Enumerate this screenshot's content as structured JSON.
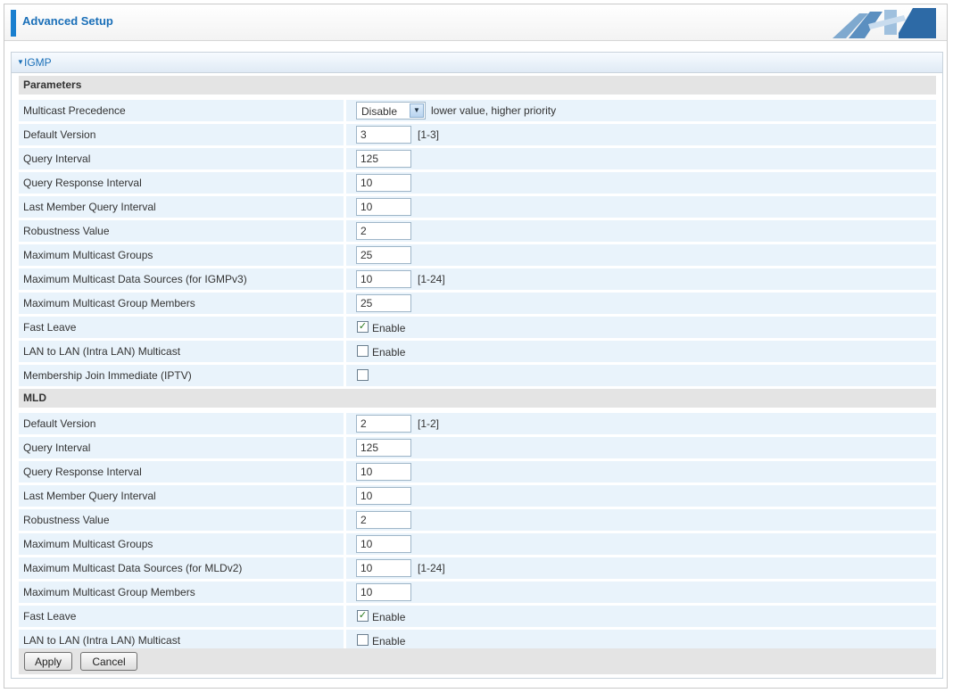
{
  "header": {
    "title": "Advanced Setup"
  },
  "panel": {
    "title": "IGMP"
  },
  "igmp": {
    "section": "Parameters",
    "precedence": {
      "label": "Multicast Precedence",
      "value": "Disable",
      "hint": "lower value, higher priority"
    },
    "default_version": {
      "label": "Default Version",
      "value": "3",
      "hint": "[1-3]"
    },
    "query_interval": {
      "label": "Query Interval",
      "value": "125"
    },
    "query_response_interval": {
      "label": "Query Response Interval",
      "value": "10"
    },
    "last_member_query_interval": {
      "label": "Last Member Query Interval",
      "value": "10"
    },
    "robustness_value": {
      "label": "Robustness Value",
      "value": "2"
    },
    "max_groups": {
      "label": "Maximum Multicast Groups",
      "value": "25"
    },
    "max_data_sources": {
      "label": "Maximum Multicast Data Sources (for IGMPv3)",
      "value": "10",
      "hint": "[1-24]"
    },
    "max_group_members": {
      "label": "Maximum Multicast Group Members",
      "value": "25"
    },
    "fast_leave": {
      "label": "Fast Leave",
      "checked": true,
      "cb_label": "Enable"
    },
    "lan_to_lan": {
      "label": "LAN to LAN (Intra LAN) Multicast",
      "checked": false,
      "cb_label": "Enable"
    },
    "join_immediate": {
      "label": "Membership Join Immediate (IPTV)",
      "checked": false
    }
  },
  "mld": {
    "section": "MLD",
    "default_version": {
      "label": "Default Version",
      "value": "2",
      "hint": "[1-2]"
    },
    "query_interval": {
      "label": "Query Interval",
      "value": "125"
    },
    "query_response_interval": {
      "label": "Query Response Interval",
      "value": "10"
    },
    "last_member_query_interval": {
      "label": "Last Member Query Interval",
      "value": "10"
    },
    "robustness_value": {
      "label": "Robustness Value",
      "value": "2"
    },
    "max_groups": {
      "label": "Maximum Multicast Groups",
      "value": "10"
    },
    "max_data_sources": {
      "label": "Maximum Multicast Data Sources (for MLDv2)",
      "value": "10",
      "hint": "[1-24]"
    },
    "max_group_members": {
      "label": "Maximum Multicast Group Members",
      "value": "10"
    },
    "fast_leave": {
      "label": "Fast Leave",
      "checked": true,
      "cb_label": "Enable"
    },
    "lan_to_lan": {
      "label": "LAN to LAN (Intra LAN) Multicast",
      "checked": false,
      "cb_label": "Enable"
    }
  },
  "buttons": {
    "apply": "Apply",
    "cancel": "Cancel"
  },
  "colors": {
    "accent": "#1a7fcf",
    "row_bg": "#e9f3fb",
    "section_bg": "#e4e4e4"
  }
}
